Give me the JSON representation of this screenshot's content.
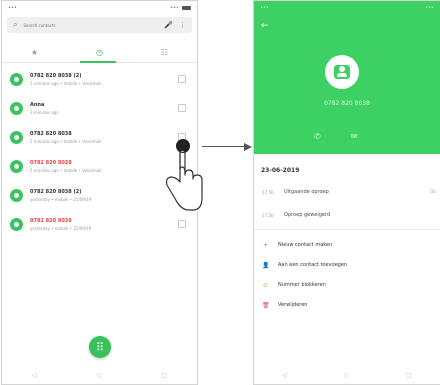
{
  "left_phone": {
    "status": {
      "time": "•••",
      "signal": "•••"
    },
    "search": {
      "placeholder": "Search contacts"
    },
    "tabs": [
      {
        "label": "★"
      },
      {
        "label": "◷"
      },
      {
        "label": "☷"
      }
    ],
    "calls": [
      {
        "title": "0782 820 8038 (2)",
        "subtitle": "2 minutes ago • mobile • Voicemail",
        "missed": false
      },
      {
        "title": "Anna",
        "subtitle": "3 minutes ago",
        "missed": false
      },
      {
        "title": "0782 820 8038",
        "subtitle": "5 minutes ago • mobile • Voicemail",
        "missed": false
      },
      {
        "title": "0782 820 8038",
        "subtitle": "5 minutes ago • mobile • Voicemail",
        "missed": true
      },
      {
        "title": "0782 820 8038 (2)",
        "subtitle": "yesterday • mobile • 21/09/19",
        "missed": false
      },
      {
        "title": "0782 820 8038",
        "subtitle": "yesterday • mobile • 21/09/19",
        "missed": true
      }
    ],
    "fab_icon": "⠿",
    "nav": [
      "◁",
      "○",
      "□"
    ]
  },
  "right_phone": {
    "back_icon": "←",
    "number": "0782 820 8038",
    "actions": [
      "✆",
      "✉"
    ],
    "date": "23-06-2019",
    "call_details": [
      {
        "time": "17:50",
        "label": "Uitgaande oproep",
        "extra": "0s"
      },
      {
        "time": "17:50",
        "label": "Oproep geweigerd",
        "extra": ""
      }
    ],
    "action_items": [
      {
        "label": "Nieuw contact maken",
        "icon": "+",
        "color": "#4a90e2"
      },
      {
        "label": "Aan een contact toevoegen",
        "icon": "👤",
        "color": "#4a90e2"
      },
      {
        "label": "Nummer blokkeren",
        "icon": "⊘",
        "color": "#f5a623"
      },
      {
        "label": "Verwijderen",
        "icon": "🗑",
        "color": "#e74646"
      }
    ],
    "nav": [
      "◁",
      "○",
      "□"
    ]
  },
  "colors": {
    "accent": "#38c25b",
    "header_green": "#3dd163",
    "missed_red": "#e74646"
  }
}
